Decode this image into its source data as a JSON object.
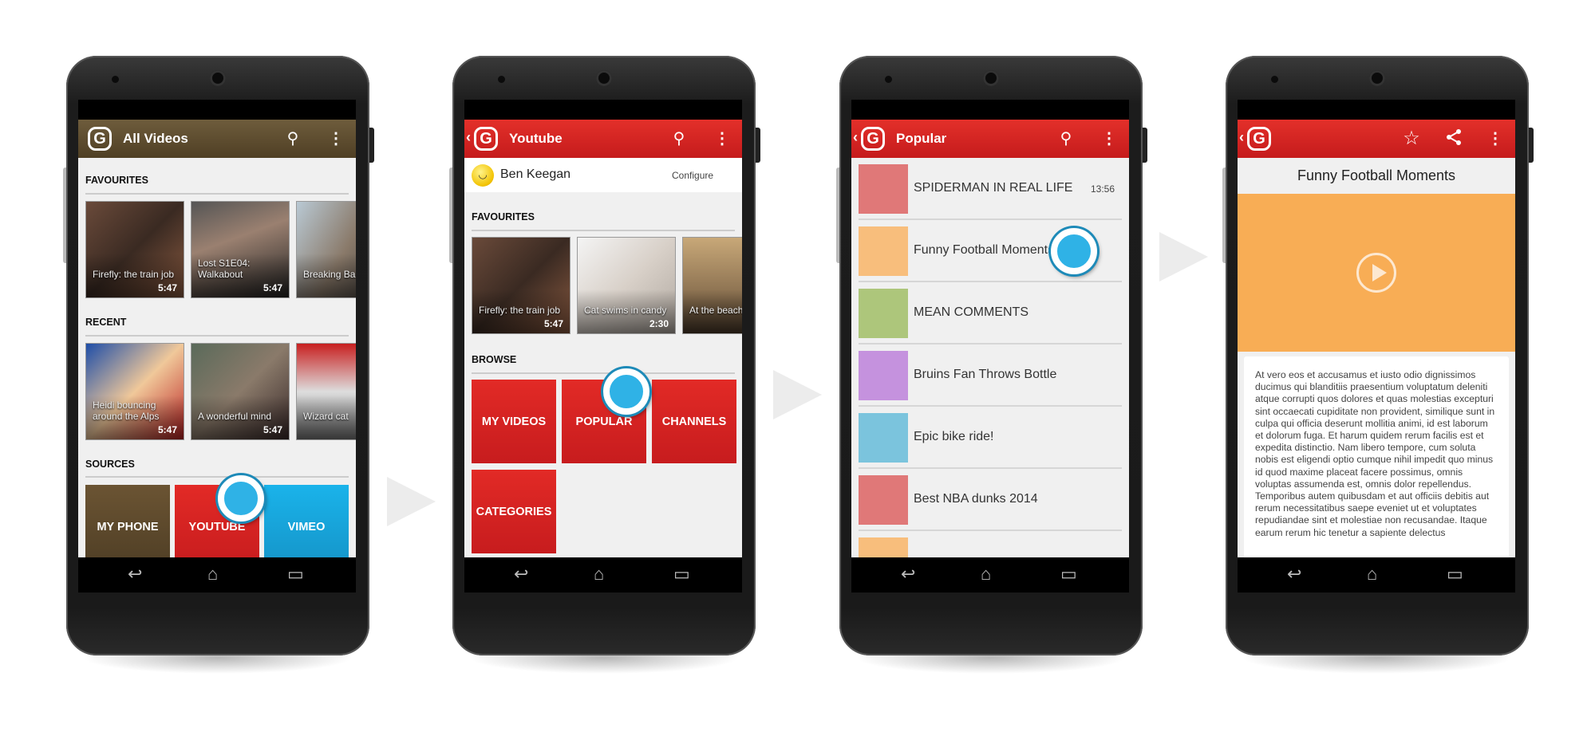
{
  "colors": {
    "brown_toolbar": "#5e4c2f",
    "red_toolbar": "#d62424",
    "touch": "#2fb2e6",
    "vimeo": "#1aa8e0"
  },
  "screen1": {
    "title": "All Videos",
    "favourites_label": "FAVOURITES",
    "favourites": [
      {
        "title": "Firefly: the train job",
        "duration": "5:47"
      },
      {
        "title": "Lost S1E04: Walkabout",
        "duration": "5:47"
      },
      {
        "title": "Breaking Ba",
        "duration": ""
      }
    ],
    "recent_label": "RECENT",
    "recent": [
      {
        "title": "Heidi bouncing around the Alps",
        "duration": "5:47"
      },
      {
        "title": "A wonderful mind",
        "duration": "5:47"
      },
      {
        "title": "Wizard cat",
        "duration": ""
      }
    ],
    "sources_label": "SOURCES",
    "sources": [
      "MY PHONE",
      "YOUTUBE",
      "VIMEO"
    ]
  },
  "screen2": {
    "title": "Youtube",
    "user": "Ben Keegan",
    "configure": "Configure",
    "favourites_label": "FAVOURITES",
    "favourites": [
      {
        "title": "Firefly: the train job",
        "duration": "5:47"
      },
      {
        "title": "Cat swims in candy",
        "duration": "2:30"
      },
      {
        "title": "At the beach",
        "duration": ""
      }
    ],
    "browse_label": "BROWSE",
    "browse": [
      "MY VIDEOS",
      "POPULAR",
      "CHANNELS",
      "CATEGORIES"
    ]
  },
  "screen3": {
    "title": "Popular",
    "items": [
      {
        "title": "SPIDERMAN IN REAL LIFE",
        "time": "13:56",
        "color": "#e07878"
      },
      {
        "title": "Funny Football Moments",
        "color": "#f8be7c"
      },
      {
        "title": "MEAN COMMENTS",
        "color": "#adc67b"
      },
      {
        "title": "Bruins Fan Throws Bottle",
        "color": "#c592de"
      },
      {
        "title": "Epic bike ride!",
        "color": "#7bc4dd"
      },
      {
        "title": "Best NBA dunks 2014",
        "color": "#e07878"
      },
      {
        "color": "#f8be7c"
      }
    ]
  },
  "screen4": {
    "title": "Funny Football Moments",
    "video_color": "#f8ad55",
    "description": "At vero eos et accusamus et iusto odio dignissimos ducimus qui blanditiis praesentium voluptatum deleniti atque corrupti quos dolores et quas molestias excepturi sint occaecati cupiditate non provident, similique sunt in culpa qui officia deserunt mollitia animi, id est laborum et dolorum fuga. Et harum quidem rerum facilis est et expedita distinctio. Nam libero tempore, cum soluta nobis est eligendi optio cumque nihil impedit quo minus id quod maxime placeat facere possimus, omnis voluptas assumenda est, omnis dolor repellendus. Temporibus autem quibusdam et aut officiis debitis aut rerum necessitatibus saepe eveniet ut et voluptates repudiandae sint et molestiae non recusandae. Itaque earum rerum hic tenetur a sapiente delectus"
  },
  "icons": {
    "logo": "G",
    "back": "‹",
    "search": "⚲",
    "menu": "⋮",
    "star": "☆",
    "share": "share-icon",
    "nav_back": "↩",
    "nav_home": "⌂",
    "nav_recents": "▭"
  }
}
